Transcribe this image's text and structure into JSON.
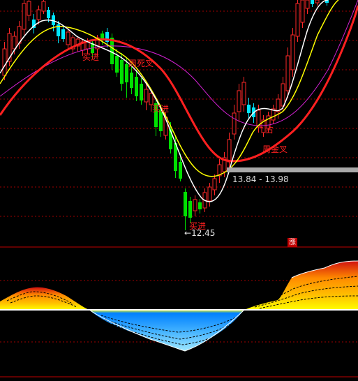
{
  "labels": {
    "buy_1": "买进",
    "week_death_cross": "周死叉",
    "buy_2": "买进",
    "range": "13.84 - 13.98",
    "buy_3": "买进",
    "low_price": "12.45",
    "trend_mark": "↑占",
    "week_golden_cross": "周金叉",
    "rise_badge": "涨"
  },
  "colors": {
    "up_candle": "#ff2828",
    "down_candle": "#00e5ff",
    "green_candle": "#00e000",
    "ma_fast": "#ffffff",
    "ma_mid": "#ffff00",
    "ma_slow": "#ff2020",
    "ma_long": "#d020d0",
    "grid": "#a00000"
  }
}
